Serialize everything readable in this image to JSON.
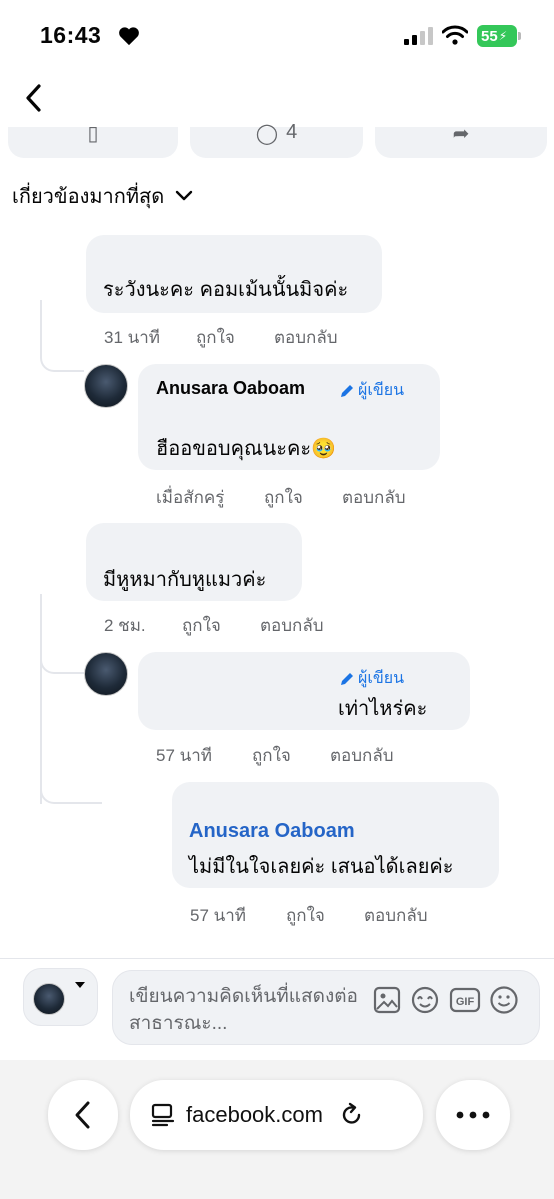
{
  "status_bar": {
    "time": "16:43",
    "battery": "55"
  },
  "sort": {
    "label": "เกี่ยวข้องมากที่สุด"
  },
  "top_actions": {
    "comment_count": "4"
  },
  "comments": [
    {
      "text": "ระวังนะคะ คอมเม้นนั้นมิจค่ะ",
      "time": "31 นาที",
      "like": "ถูกใจ",
      "reply": "ตอบกลับ"
    },
    {
      "author": "Anusara Oaboam",
      "badge": "ผู้เขียน",
      "text": "ฮืออขอบคุณนะคะ🥹",
      "time": "เมื่อสักครู่",
      "like": "ถูกใจ",
      "reply": "ตอบกลับ"
    },
    {
      "text": "มีหูหมากับหูแมวค่ะ",
      "time": "2 ชม.",
      "like": "ถูกใจ",
      "reply": "ตอบกลับ"
    },
    {
      "badge": "ผู้เขียน",
      "text": "เท่าไหร่คะ",
      "time": "57 นาที",
      "like": "ถูกใจ",
      "reply": "ตอบกลับ"
    },
    {
      "author": "Anusara Oaboam",
      "text": "ไม่มีในใจเลยค่ะ เสนอได้เลยค่ะ",
      "time": "57 นาที",
      "like": "ถูกใจ",
      "reply": "ตอบกลับ"
    }
  ],
  "composer": {
    "placeholder": "เขียนความคิดเห็นที่แสดงต่อสาธารณะ..."
  },
  "browser": {
    "url": "facebook.com"
  },
  "colors": {
    "link_blue": "#2565c7",
    "badge_blue": "#1b74e4",
    "battery_green": "#34c759"
  }
}
